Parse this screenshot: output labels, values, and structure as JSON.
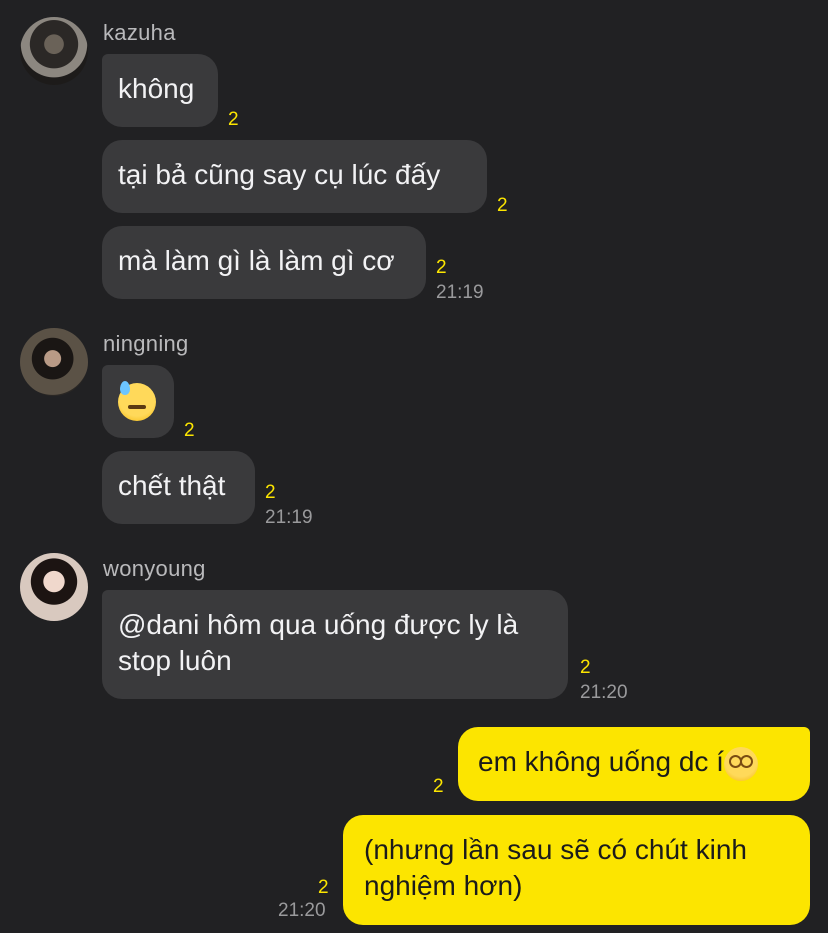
{
  "messages": {
    "kazuha": {
      "name": "kazuha",
      "m1": {
        "text": "không",
        "unread": "2"
      },
      "m2": {
        "text": "tại bả cũng say cụ lúc đấy",
        "unread": "2"
      },
      "m3": {
        "text": "mà làm gì là làm gì cơ",
        "unread": "2",
        "time": "21:19"
      }
    },
    "ningning": {
      "name": "ningning",
      "m1": {
        "emoji": "downcast-face-with-sweat-emoji",
        "unread": "2"
      },
      "m2": {
        "text": "chết thật",
        "unread": "2",
        "time": "21:19"
      }
    },
    "wonyoung": {
      "name": "wonyoung",
      "m1": {
        "line1": "@dani hôm qua uống được ly là",
        "line2": "stop luôn",
        "unread": "2",
        "time": "21:20"
      }
    },
    "me": {
      "m1": {
        "text": "em không uống dc í",
        "emoji": "dizzy-face-emoji",
        "unread": "2"
      },
      "m2": {
        "line1": "(nhưng lần sau sẽ có chút kinh",
        "line2": "nghiệm hơn)",
        "unread": "2",
        "time": "21:20"
      }
    }
  },
  "colors": {
    "background": "#212123",
    "incoming_bubble": "#3a3a3c",
    "outgoing_bubble": "#fce500",
    "unread_count": "#fce500",
    "timestamp": "#9a9a9c"
  }
}
